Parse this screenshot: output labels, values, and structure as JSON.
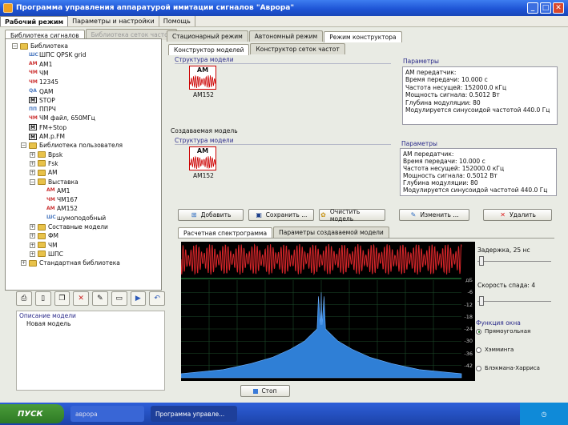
{
  "window": {
    "title": "Программа управления аппаратурой имитации сигналов \"Аврора\""
  },
  "menu": [
    "Рабочий режим",
    "Параметры и настройки",
    "Помощь"
  ],
  "left_tabs": [
    "Библиотека сигналов",
    "Библиотека сеток частот"
  ],
  "mode_tabs": [
    "Стационарный режим",
    "Автономный режим",
    "Режим конструктора"
  ],
  "constructor_tabs": [
    "Конструктор моделей",
    "Конструктор сеток частот"
  ],
  "tree": [
    {
      "label": "Библиотека",
      "level": 0,
      "icon": "folder-icon",
      "exp": "−"
    },
    {
      "label": "ШПС QPSK grid",
      "level": 1,
      "icon": "signal-icon",
      "badge": "ШС"
    },
    {
      "label": "AM1",
      "level": 1,
      "icon": "am-icon",
      "badge": "AM"
    },
    {
      "label": "ЧМ",
      "level": 1,
      "icon": "fm-icon",
      "badge": "ЧМ"
    },
    {
      "label": "12345",
      "level": 1,
      "icon": "fm-icon",
      "badge": "ЧМ"
    },
    {
      "label": "QAM",
      "level": 1,
      "icon": "qam-icon",
      "badge": "QA"
    },
    {
      "label": "STOP",
      "level": 1,
      "icon": "m-icon",
      "badge": "M"
    },
    {
      "label": "ППРЧ",
      "level": 1,
      "icon": "hop-icon",
      "badge": "ПП"
    },
    {
      "label": "ЧМ файл, 650МГц",
      "level": 1,
      "icon": "fm-icon",
      "badge": "ЧМ"
    },
    {
      "label": "FM+Stop",
      "level": 1,
      "icon": "m-icon",
      "badge": "M"
    },
    {
      "label": "AM.p.FM",
      "level": 1,
      "icon": "m-icon",
      "badge": "M"
    },
    {
      "label": "Библиотека пользователя",
      "level": 1,
      "icon": "folder-icon",
      "exp": "−"
    },
    {
      "label": "Bpsk",
      "level": 2,
      "icon": "folder-icon",
      "exp": "+"
    },
    {
      "label": "Fsk",
      "level": 2,
      "icon": "folder-icon",
      "exp": "+"
    },
    {
      "label": "AM",
      "level": 2,
      "icon": "folder-icon",
      "exp": "+"
    },
    {
      "label": "Выставка",
      "level": 2,
      "icon": "folder-icon",
      "exp": "−"
    },
    {
      "label": "AM1",
      "level": 3,
      "icon": "am-icon",
      "badge": "AM"
    },
    {
      "label": "ЧМ167",
      "level": 3,
      "icon": "fm-icon",
      "badge": "ЧМ"
    },
    {
      "label": "AM152",
      "level": 3,
      "icon": "am-icon",
      "badge": "AM"
    },
    {
      "label": "шумоподобный",
      "level": 3,
      "icon": "signal-icon",
      "badge": "ШС"
    },
    {
      "label": "Составные модели",
      "level": 2,
      "icon": "folder-icon",
      "exp": "+"
    },
    {
      "label": "ФМ",
      "level": 2,
      "icon": "folder-icon",
      "exp": "+"
    },
    {
      "label": "ЧМ",
      "level": 2,
      "icon": "folder-icon",
      "exp": "+"
    },
    {
      "label": "ШПС",
      "level": 2,
      "icon": "folder-icon",
      "exp": "+"
    },
    {
      "label": "Стандартная библиотека",
      "level": 1,
      "icon": "folder-icon",
      "exp": "+"
    }
  ],
  "description": {
    "title": "Описание модели",
    "value": "Новая модель"
  },
  "section1": {
    "group": "Структура модели",
    "model_badge": "AM",
    "model_name": "AM152",
    "params_title": "Параметры"
  },
  "section2": {
    "title": "Создаваемая модель",
    "group": "Структура модели",
    "model_badge": "AM",
    "model_name": "AM152",
    "params_title": "Параметры"
  },
  "params": [
    "АМ передатчик:",
    "Время передачи: 10.000 с",
    "Частота несущей: 152000.0 кГц",
    "Мощность сигнала: 0.5012 Вт",
    "Глубина модуляции: 80",
    "Модулируется синусоидой частотой 440.0 Гц"
  ],
  "buttons": {
    "add": "Добавить",
    "save": "Сохранить ...",
    "clear": "Очистить модель",
    "edit": "Изменить ...",
    "delete": "Удалить",
    "stop": "Стоп"
  },
  "bottom_tabs": [
    "Расчетная спектрограмма",
    "Параметры создаваемой модели"
  ],
  "controls": {
    "delay_label": "Задержка, 25 нс",
    "decay_label": "Скорость спада: 4",
    "window_title": "Функция окна",
    "window_options": [
      "Прямоугольная",
      "Хэмминга",
      "Блэкмана-Харриса"
    ],
    "selected_window": 0
  },
  "chart_data": {
    "type": "line",
    "ylabel": "дБ",
    "yticks": [
      -6,
      -12,
      -18,
      -24,
      -30,
      -36,
      -42
    ],
    "ylim": [
      -48,
      0
    ],
    "series": [
      {
        "points_x": [
          -1,
          -0.7,
          -0.5,
          -0.35,
          -0.22,
          -0.12,
          -0.06,
          -0.03,
          -0.02,
          -0.005,
          0,
          0.005,
          0.02,
          0.03,
          0.06,
          0.12,
          0.22,
          0.35,
          0.5,
          0.7,
          1
        ],
        "points_y": [
          -46,
          -44,
          -41,
          -38,
          -34,
          -30,
          -26,
          -24,
          -8,
          -22,
          -6,
          -22,
          -8,
          -24,
          -26,
          -30,
          -34,
          -38,
          -41,
          -44,
          -46
        ]
      }
    ],
    "colors": {
      "spectrum": "#2f7fd6",
      "waveform": "#d8262a"
    }
  },
  "taskbar": {
    "start": "ПУСК",
    "tasks": [
      "аврора",
      "Программа управле..."
    ]
  }
}
